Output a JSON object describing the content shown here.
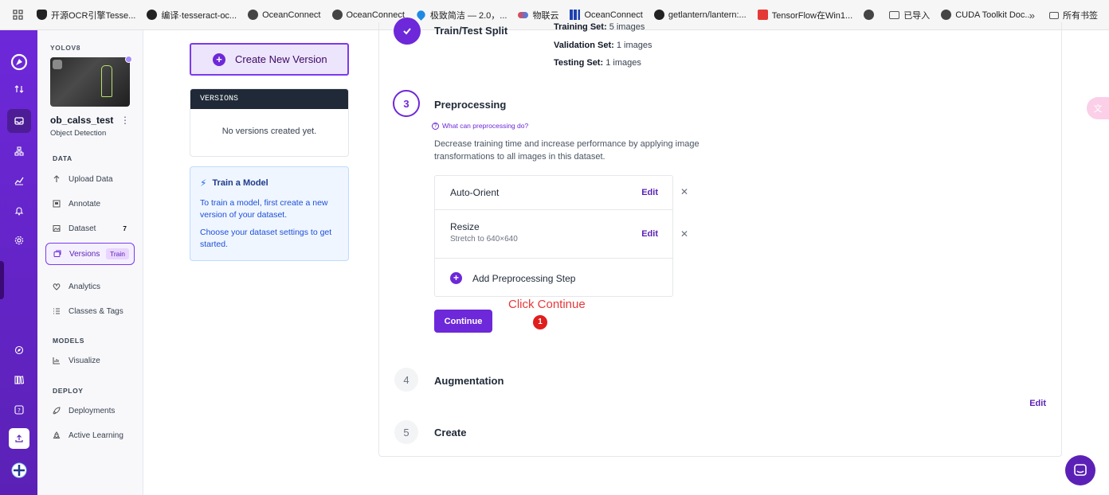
{
  "bookmarks": [
    {
      "label": "开源OCR引擎Tesse...",
      "icon": "shield-icon",
      "color": "#222222"
    },
    {
      "label": "编译·tesseract-oc...",
      "icon": "github-icon",
      "color": "#222222"
    },
    {
      "label": "OceanConnect",
      "icon": "globe-icon",
      "color": "#444444"
    },
    {
      "label": "OceanConnect",
      "icon": "globe-icon",
      "color": "#444444"
    },
    {
      "label": "极致简洁 — 2.0，...",
      "icon": "drop-icon",
      "color": "#1e88e5"
    },
    {
      "label": "物联云",
      "icon": "cloud-icon",
      "color": "#ef4444"
    },
    {
      "label": "OceanConnect",
      "icon": "bars-icon",
      "color": "#1e40af"
    },
    {
      "label": "getlantern/lantern:...",
      "icon": "github-icon",
      "color": "#222222"
    },
    {
      "label": "TensorFlow在Win1...",
      "icon": "c-icon",
      "color": "#e53935"
    },
    {
      "label": "",
      "icon": "globe-icon",
      "color": "#444444"
    },
    {
      "label": "已导入",
      "icon": "folder-icon",
      "color": "#555555"
    },
    {
      "label": "CUDA Toolkit Doc...",
      "icon": "globe-icon",
      "color": "#444444"
    }
  ],
  "bookmarks_more": "»",
  "bookmarks_all": "所有书签",
  "project": {
    "tag": "YOLOV8",
    "name": "ob_calss_test",
    "type": "Object Detection",
    "menu_glyph": "⋮"
  },
  "sidebar": {
    "data_heading": "DATA",
    "models_heading": "MODELS",
    "deploy_heading": "DEPLOY",
    "items": [
      {
        "label": "Upload Data",
        "icon": "upload-arrow-icon"
      },
      {
        "label": "Annotate",
        "icon": "annotate-icon"
      },
      {
        "label": "Dataset",
        "icon": "image-icon",
        "count": "7"
      },
      {
        "label": "Versions",
        "icon": "versions-icon",
        "badge": "Train",
        "active": true
      },
      {
        "label": "Analytics",
        "icon": "analytics-icon"
      },
      {
        "label": "Classes & Tags",
        "icon": "list-icon"
      },
      {
        "label": "Visualize",
        "icon": "chart-icon"
      },
      {
        "label": "Deployments",
        "icon": "rocket-icon"
      },
      {
        "label": "Active Learning",
        "icon": "recycle-icon"
      }
    ]
  },
  "left_panel": {
    "create_label": "Create New Version",
    "versions_heading": "VERSIONS",
    "versions_empty": "No versions created yet.",
    "train_title": "Train a Model",
    "train_p1": "To train a model, first create a new version of your dataset.",
    "train_p2": "Choose your dataset settings to get started."
  },
  "steps": {
    "split": {
      "title": "Train/Test Split",
      "training_label": "Training Set:",
      "training_value": "5 images",
      "validation_label": "Validation Set:",
      "validation_value": "1 images",
      "testing_label": "Testing Set:",
      "testing_value": "1 images"
    },
    "preprocessing": {
      "number": "3",
      "title": "Preprocessing",
      "help_link": "What can preprocessing do?",
      "description": "Decrease training time and increase performance by applying image transformations to all images in this dataset.",
      "items": [
        {
          "name": "Auto-Orient",
          "detail": "",
          "edit": "Edit"
        },
        {
          "name": "Resize",
          "detail": "Stretch to 640×640",
          "edit": "Edit"
        }
      ],
      "add_label": "Add Preprocessing Step",
      "continue_label": "Continue"
    },
    "augmentation": {
      "number": "4",
      "title": "Augmentation",
      "edit": "Edit"
    },
    "create": {
      "number": "5",
      "title": "Create"
    }
  },
  "annotation": {
    "text": "Click Continue",
    "number": "1"
  },
  "colors": {
    "brand": "#6d28d9",
    "annotation": "#e5393a"
  }
}
